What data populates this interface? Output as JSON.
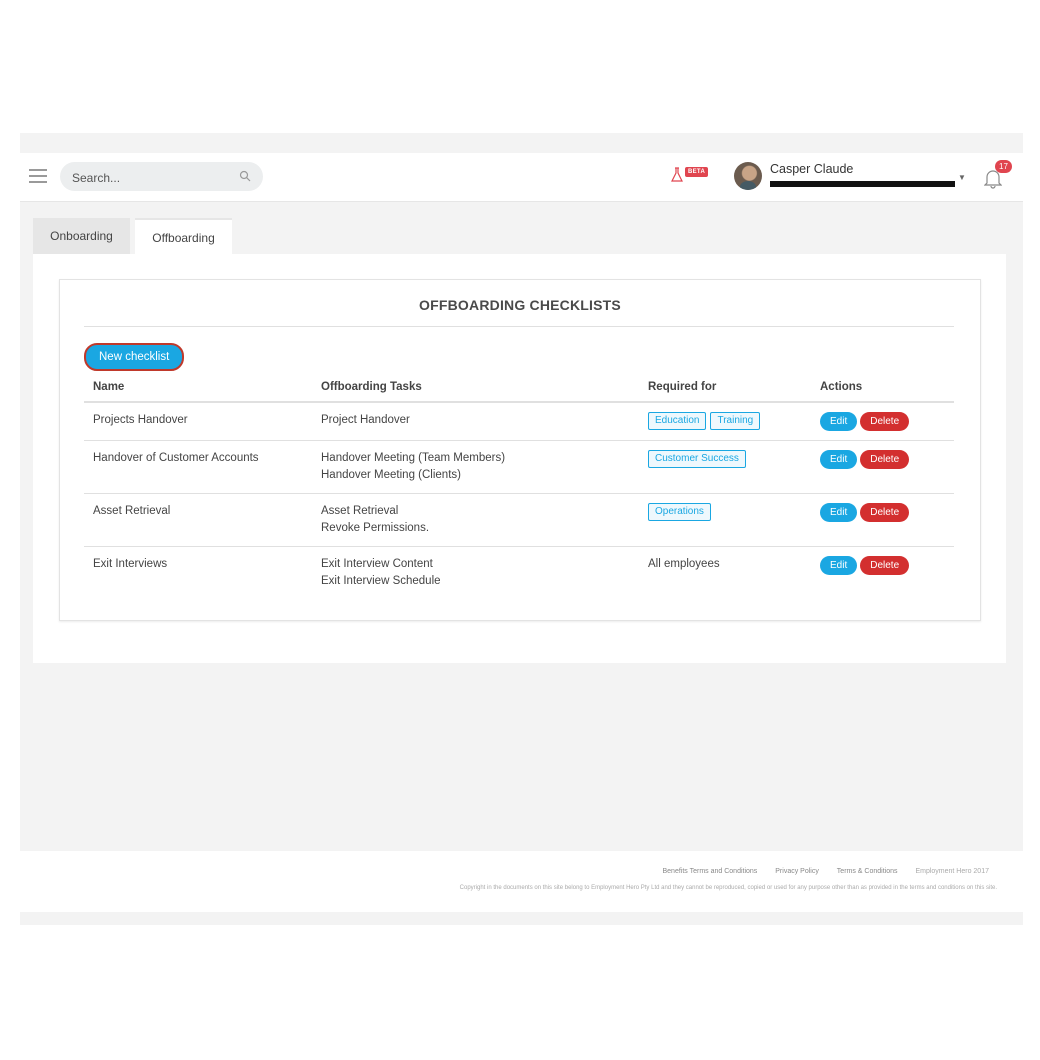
{
  "topbar": {
    "search_placeholder": "Search...",
    "beta_label": "BETA",
    "user_name": "Casper Claude",
    "notification_count": "17"
  },
  "tabs": [
    {
      "label": "Onboarding",
      "active": false
    },
    {
      "label": "Offboarding",
      "active": true
    }
  ],
  "card": {
    "title": "OFFBOARDING CHECKLISTS",
    "new_button": "New checklist",
    "columns": [
      "Name",
      "Offboarding Tasks",
      "Required for",
      "Actions"
    ],
    "rows": [
      {
        "name": "Projects Handover",
        "tasks": [
          "Project Handover"
        ],
        "tags": [
          "Education",
          "Training"
        ],
        "required_text": ""
      },
      {
        "name": "Handover of Customer Accounts",
        "tasks": [
          "Handover Meeting (Team Members)",
          "Handover Meeting (Clients)"
        ],
        "tags": [
          "Customer Success"
        ],
        "required_text": ""
      },
      {
        "name": "Asset Retrieval",
        "tasks": [
          "Asset Retrieval",
          "Revoke Permissions."
        ],
        "tags": [
          "Operations"
        ],
        "required_text": ""
      },
      {
        "name": "Exit Interviews",
        "tasks": [
          "Exit Interview Content",
          "Exit Interview Schedule"
        ],
        "tags": [],
        "required_text": "All employees"
      }
    ],
    "edit_label": "Edit",
    "delete_label": "Delete"
  },
  "footer": {
    "links": [
      "Benefits Terms and Conditions",
      "Privacy Policy",
      "Terms & Conditions"
    ],
    "brand": "Employment Hero 2017",
    "copyright": "Copyright in the documents on this site belong to Employment Hero Pty Ltd and they cannot be reproduced, copied or used for any purpose other than as provided in the terms and conditions on this site."
  },
  "colors": {
    "accent": "#1aa7e2",
    "danger": "#d32f2f",
    "badge": "#e0454f"
  }
}
